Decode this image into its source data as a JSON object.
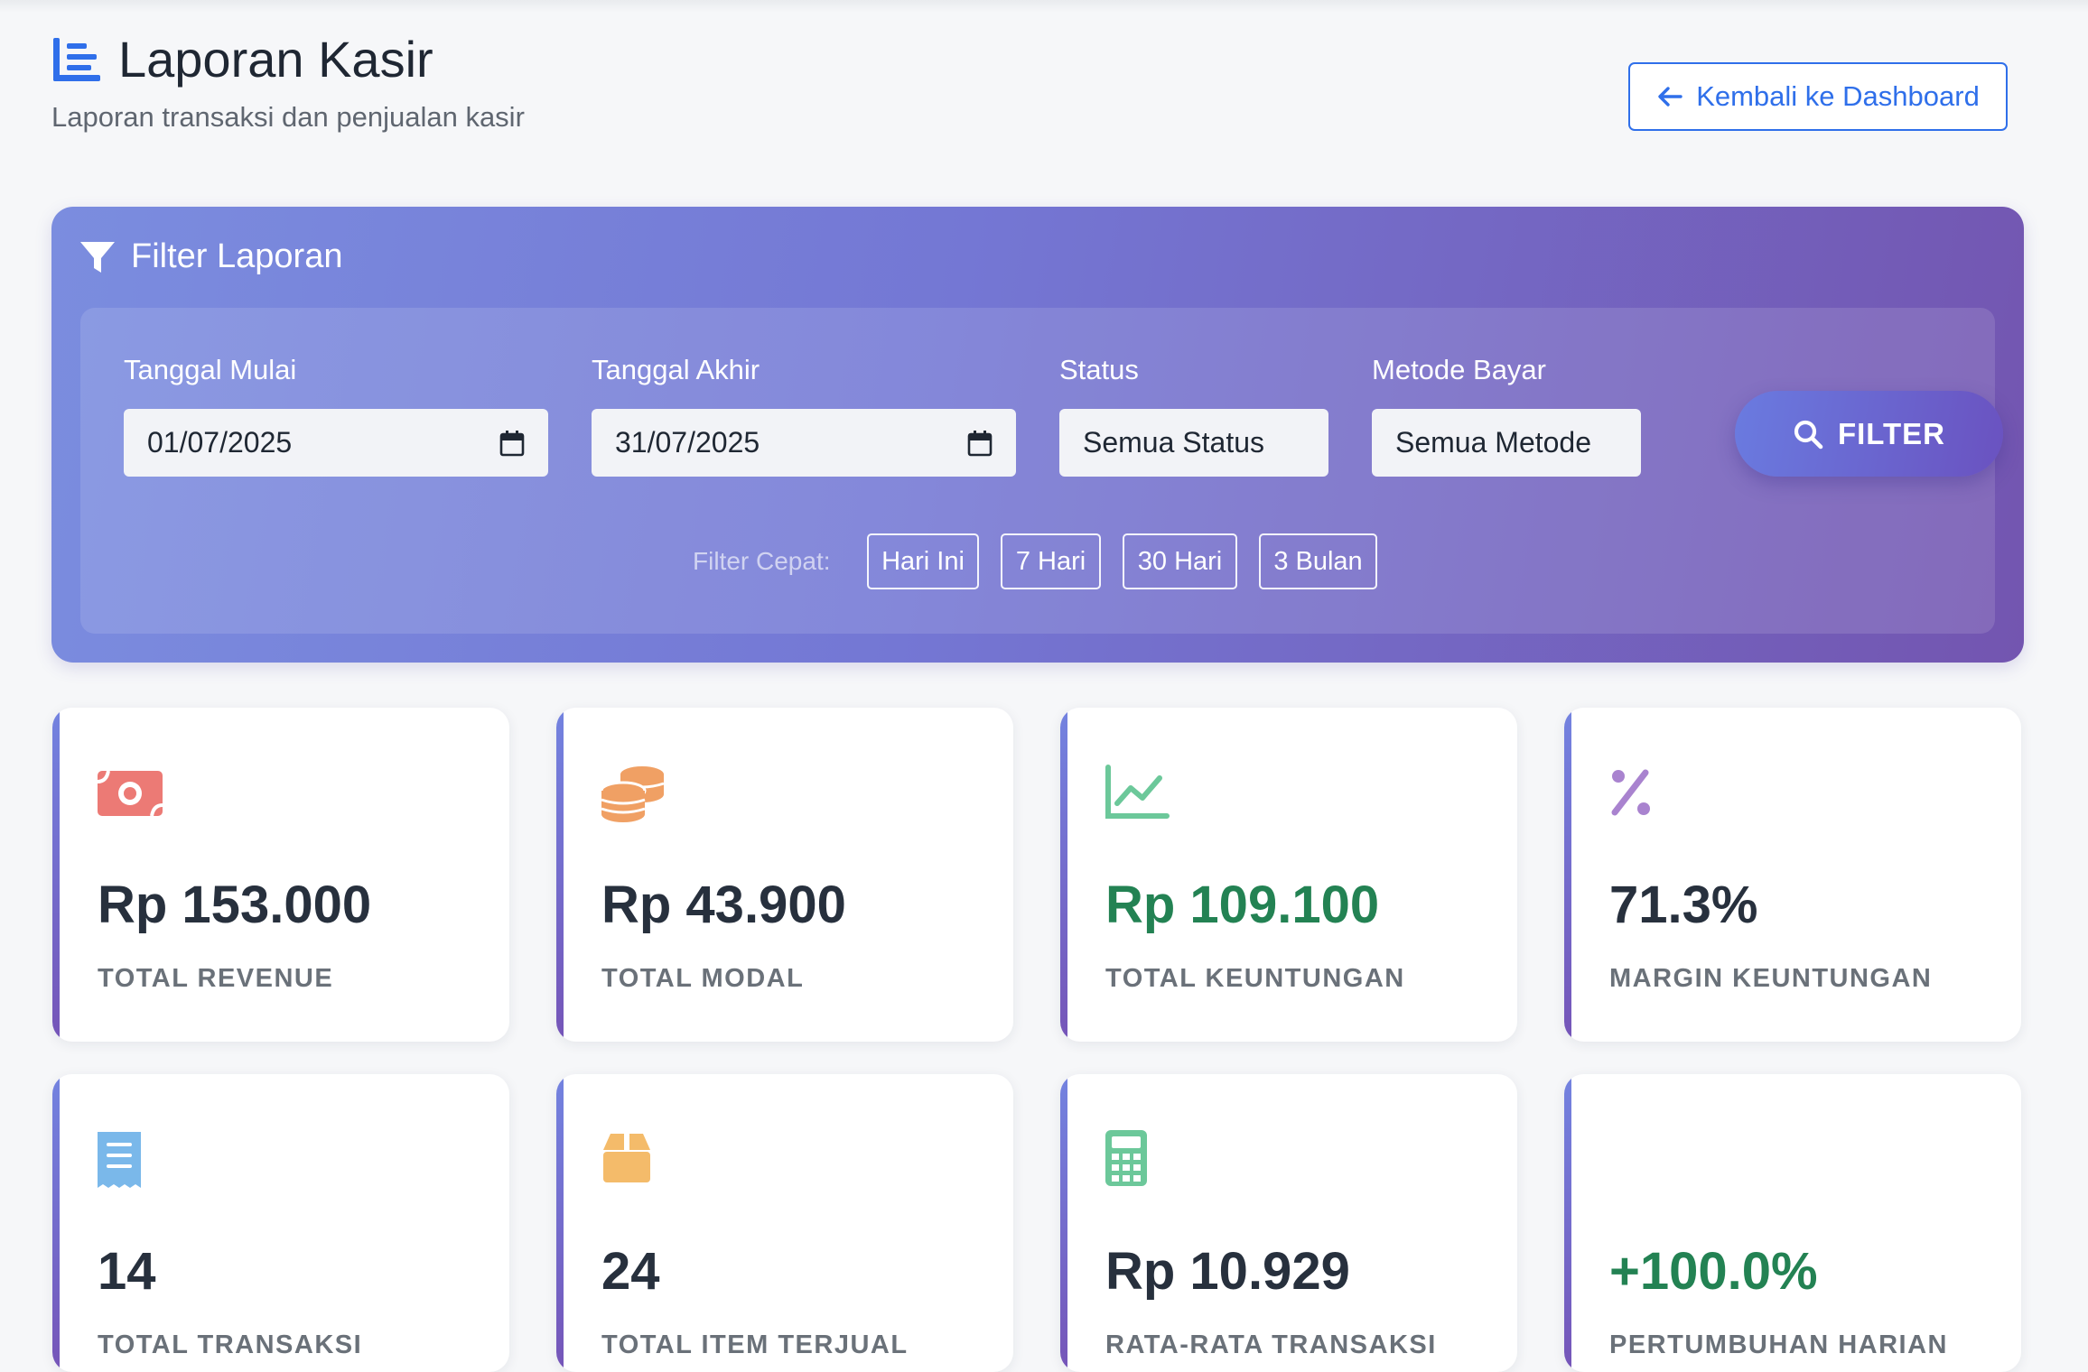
{
  "header": {
    "title": "Laporan Kasir",
    "subtitle": "Laporan transaksi dan penjualan kasir",
    "back_label": "Kembali ke Dashboard",
    "title_icon": "list-report-icon"
  },
  "filter": {
    "title": "Filter Laporan",
    "start_label": "Tanggal Mulai",
    "start_value": "01/07/2025",
    "end_label": "Tanggal Akhir",
    "end_value": "31/07/2025",
    "status_label": "Status",
    "status_value": "Semua Status",
    "method_label": "Metode Bayar",
    "method_value": "Semua Metode",
    "button_label": "FILTER",
    "quick_label": "Filter Cepat:",
    "quick": [
      "Hari Ini",
      "7 Hari",
      "30 Hari",
      "3 Bulan"
    ]
  },
  "stats": [
    {
      "value": "Rp 153.000",
      "label": "TOTAL REVENUE",
      "icon": "money-bill-icon",
      "color": "#ec7a75"
    },
    {
      "value": "Rp 43.900",
      "label": "TOTAL MODAL",
      "icon": "coins-icon",
      "color": "#f0a064"
    },
    {
      "value": "Rp 109.100",
      "label": "TOTAL KEUNTUNGAN",
      "icon": "chart-line-icon",
      "color": "#6cc89a"
    },
    {
      "value": "71.3%",
      "label": "MARGIN KEUNTUNGAN",
      "icon": "percent-icon",
      "color": "#a983cf"
    },
    {
      "value": "14",
      "label": "TOTAL TRANSAKSI",
      "icon": "receipt-icon",
      "color": "#7ab8ea"
    },
    {
      "value": "24",
      "label": "TOTAL ITEM TERJUAL",
      "icon": "box-icon",
      "color": "#f4bb6a"
    },
    {
      "value": "Rp 10.929",
      "label": "RATA-RATA TRANSAKSI",
      "icon": "calculator-icon",
      "color": "#6cc89a"
    },
    {
      "value": "+100.0%",
      "label": "PERTUMBUHAN HARIAN",
      "icon": "",
      "color": "#238253"
    }
  ],
  "colors": {
    "accent": "#2f6fea",
    "green": "#238253",
    "gradient_start": "#7b8ddf",
    "gradient_end": "#7355b0"
  }
}
